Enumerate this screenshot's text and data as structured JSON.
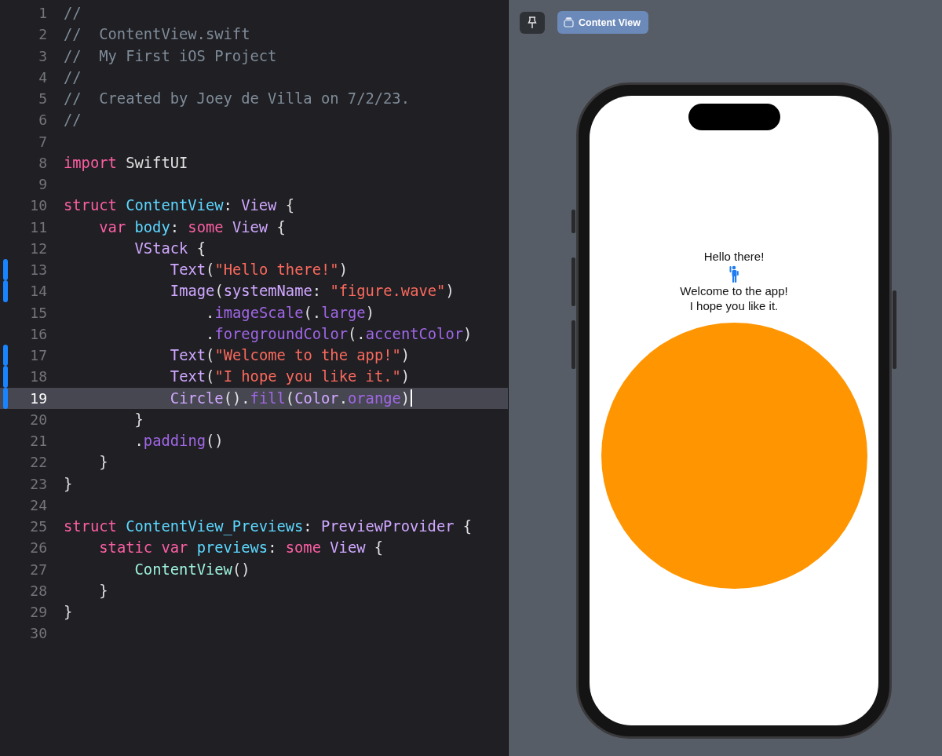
{
  "editor": {
    "lines": [
      {
        "number": "1",
        "changed": false,
        "current": false,
        "tokens": [
          {
            "kind": "comment",
            "text": "//"
          }
        ]
      },
      {
        "number": "2",
        "changed": false,
        "current": false,
        "tokens": [
          {
            "kind": "comment",
            "text": "//  ContentView.swift"
          }
        ]
      },
      {
        "number": "3",
        "changed": false,
        "current": false,
        "tokens": [
          {
            "kind": "comment",
            "text": "//  My First iOS Project"
          }
        ]
      },
      {
        "number": "4",
        "changed": false,
        "current": false,
        "tokens": [
          {
            "kind": "comment",
            "text": "//"
          }
        ]
      },
      {
        "number": "5",
        "changed": false,
        "current": false,
        "tokens": [
          {
            "kind": "comment",
            "text": "//  Created by Joey de Villa on 7/2/23."
          }
        ]
      },
      {
        "number": "6",
        "changed": false,
        "current": false,
        "tokens": [
          {
            "kind": "comment",
            "text": "//"
          }
        ]
      },
      {
        "number": "7",
        "changed": false,
        "current": false
      },
      {
        "number": "8",
        "changed": false,
        "current": false,
        "tokens": [
          {
            "kind": "keyword",
            "text": "import"
          },
          {
            "kind": "plain",
            "text": " SwiftUI"
          }
        ]
      },
      {
        "number": "9",
        "changed": false,
        "current": false
      },
      {
        "number": "10",
        "changed": false,
        "current": false,
        "tokens": [
          {
            "kind": "keyword",
            "text": "struct "
          },
          {
            "kind": "decl",
            "text": "ContentView"
          },
          {
            "kind": "plain",
            "text": ": "
          },
          {
            "kind": "type",
            "text": "View"
          },
          {
            "kind": "plain",
            "text": " {"
          }
        ],
        "children": [
          {
            "number": "11",
            "changed": false,
            "current": false,
            "tokens": [
              {
                "kind": "keyword",
                "text": "var "
              },
              {
                "kind": "decl",
                "text": "body"
              },
              {
                "kind": "plain",
                "text": ": "
              },
              {
                "kind": "keyword",
                "text": "some "
              },
              {
                "kind": "type",
                "text": "View"
              },
              {
                "kind": "plain",
                "text": " {"
              }
            ],
            "children": [
              {
                "number": "12",
                "changed": false,
                "current": false,
                "tokens": [
                  {
                    "kind": "type",
                    "text": "VStack"
                  },
                  {
                    "kind": "plain",
                    "text": " {"
                  }
                ],
                "children": [
                  {
                    "number": "13",
                    "changed": true,
                    "current": false,
                    "tokens": [
                      {
                        "kind": "type",
                        "text": "Text"
                      },
                      {
                        "kind": "plain",
                        "text": "("
                      },
                      {
                        "kind": "string",
                        "text": "\"Hello there!\""
                      },
                      {
                        "kind": "plain",
                        "text": ")"
                      }
                    ]
                  },
                  {
                    "number": "14",
                    "changed": true,
                    "current": false,
                    "tokens": [
                      {
                        "kind": "type",
                        "text": "Image"
                      },
                      {
                        "kind": "plain",
                        "text": "("
                      },
                      {
                        "kind": "type",
                        "text": "systemName"
                      },
                      {
                        "kind": "plain",
                        "text": ": "
                      },
                      {
                        "kind": "string",
                        "text": "\"figure.wave\""
                      },
                      {
                        "kind": "plain",
                        "text": ")"
                      }
                    ],
                    "children": [
                      {
                        "number": "15",
                        "changed": false,
                        "current": false,
                        "tokens": [
                          {
                            "kind": "member",
                            "text": ".imageScale"
                          },
                          {
                            "kind": "plain",
                            "text": "(."
                          },
                          {
                            "kind": "func",
                            "text": "large"
                          },
                          {
                            "kind": "plain",
                            "text": ")"
                          }
                        ]
                      },
                      {
                        "number": "16",
                        "changed": false,
                        "current": false,
                        "tokens": [
                          {
                            "kind": "member",
                            "text": ".foregroundColor"
                          },
                          {
                            "kind": "plain",
                            "text": "(."
                          },
                          {
                            "kind": "func",
                            "text": "accentColor"
                          },
                          {
                            "kind": "plain",
                            "text": ")"
                          }
                        ]
                      }
                    ]
                  },
                  {
                    "number": "17",
                    "changed": true,
                    "current": false,
                    "tokens": [
                      {
                        "kind": "type",
                        "text": "Text"
                      },
                      {
                        "kind": "plain",
                        "text": "("
                      },
                      {
                        "kind": "string",
                        "text": "\"Welcome to the app!\""
                      },
                      {
                        "kind": "plain",
                        "text": ")"
                      }
                    ]
                  },
                  {
                    "number": "18",
                    "changed": true,
                    "current": false,
                    "tokens": [
                      {
                        "kind": "type",
                        "text": "Text"
                      },
                      {
                        "kind": "plain",
                        "text": "("
                      },
                      {
                        "kind": "string",
                        "text": "\"I hope you like it.\""
                      },
                      {
                        "kind": "plain",
                        "text": ")"
                      }
                    ]
                  },
                  {
                    "number": "19",
                    "changed": true,
                    "current": true,
                    "tokens": [
                      {
                        "kind": "type",
                        "text": "Circle"
                      },
                      {
                        "kind": "plain",
                        "text": "()."
                      },
                      {
                        "kind": "func",
                        "text": "fill"
                      },
                      {
                        "kind": "plain",
                        "text": "("
                      },
                      {
                        "kind": "type",
                        "text": "Color"
                      },
                      {
                        "kind": "plain",
                        "text": "."
                      },
                      {
                        "kind": "func",
                        "text": "orange"
                      },
                      {
                        "kind": "plain",
                        "text": ")"
                      }
                    ]
                  }
                ]
              },
              {
                "number": "20",
                "changed": false,
                "current": false,
                "tokens": [
                  {
                    "kind": "plain",
                    "text": "}"
                  }
                ]
              },
              {
                "number": "21",
                "changed": false,
                "current": false,
                "tokens": [
                  {
                    "kind": "plain",
                    "text": "."
                  },
                  {
                    "kind": "func",
                    "text": "padding"
                  },
                  {
                    "kind": "plain",
                    "text": "()"
                  }
                ]
              }
            ]
          },
          {
            "number": "22",
            "changed": false,
            "current": false,
            "tokens": [
              {
                "kind": "plain",
                "text": "}"
              }
            ]
          }
        ]
      },
      {
        "number": "23",
        "changed": false,
        "current": false,
        "tokens": [
          {
            "kind": "plain",
            "text": "}"
          }
        ]
      },
      {
        "number": "24",
        "changed": false,
        "current": false
      },
      {
        "number": "25",
        "changed": false,
        "current": false,
        "tokens": [
          {
            "kind": "keyword",
            "text": "struct "
          },
          {
            "kind": "decl",
            "text": "ContentView_Previews"
          },
          {
            "kind": "plain",
            "text": ": "
          },
          {
            "kind": "type",
            "text": "PreviewProvider"
          },
          {
            "kind": "plain",
            "text": " {"
          }
        ],
        "children": [
          {
            "number": "26",
            "changed": false,
            "current": false,
            "tokens": [
              {
                "kind": "keyword",
                "text": "static var "
              },
              {
                "kind": "decl",
                "text": "previews"
              },
              {
                "kind": "plain",
                "text": ": "
              },
              {
                "kind": "keyword",
                "text": "some "
              },
              {
                "kind": "type",
                "text": "View"
              },
              {
                "kind": "plain",
                "text": " {"
              }
            ],
            "children": [
              {
                "number": "27",
                "changed": false,
                "current": false,
                "tokens": [
                  {
                    "kind": "project",
                    "text": "ContentView"
                  },
                  {
                    "kind": "plain",
                    "text": "()"
                  }
                ]
              }
            ]
          },
          {
            "number": "28",
            "changed": false,
            "current": false,
            "tokens": [
              {
                "kind": "plain",
                "text": "}"
              }
            ]
          }
        ]
      },
      {
        "number": "29",
        "changed": false,
        "current": false,
        "tokens": [
          {
            "kind": "plain",
            "text": "}"
          }
        ]
      },
      {
        "number": "30",
        "changed": false,
        "current": false
      }
    ]
  },
  "canvas": {
    "preview_tab": {
      "label": "Content View",
      "selected": true
    },
    "device": {
      "items": [
        {
          "kind": "text",
          "text": "Hello there!"
        },
        {
          "kind": "icon"
        },
        {
          "kind": "text",
          "text": "Welcome to the app!"
        },
        {
          "kind": "text",
          "text": "I hope you like it."
        },
        {
          "kind": "circle"
        }
      ]
    }
  }
}
